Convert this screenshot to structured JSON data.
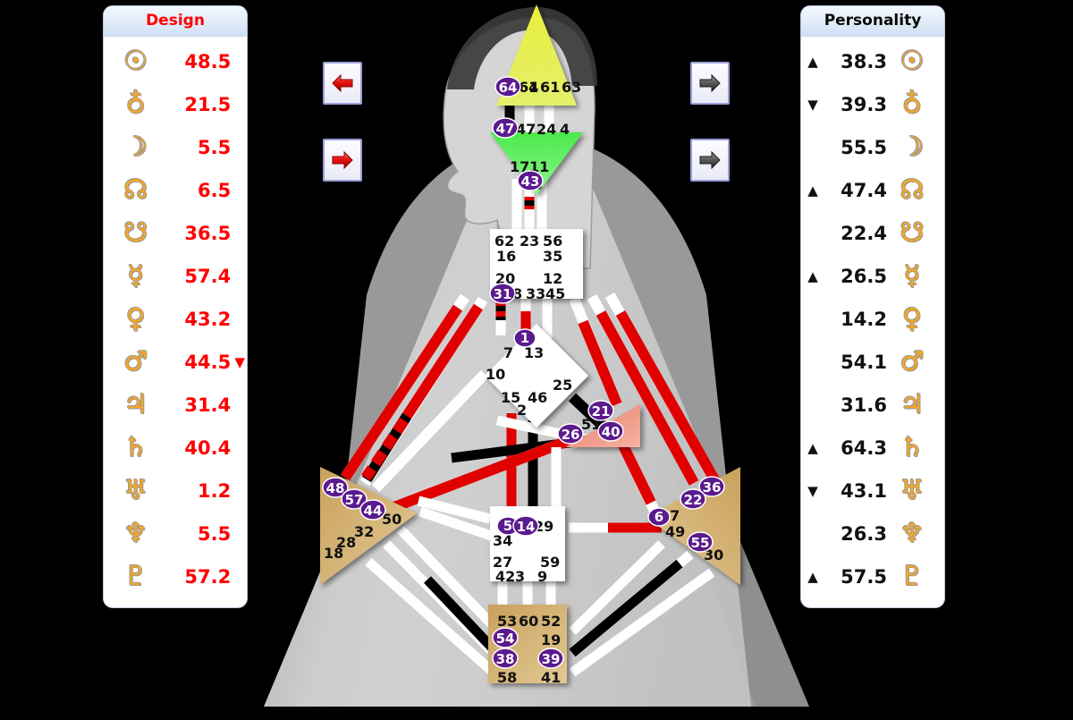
{
  "design_panel": {
    "title": "Design",
    "accent": "#ff0000",
    "rows": [
      {
        "glyph": "sun-icon",
        "symbol": "☉",
        "value": "48.5",
        "mark": ""
      },
      {
        "glyph": "earth-icon",
        "symbol": "♁",
        "value": "21.5",
        "mark": ""
      },
      {
        "glyph": "moon-icon",
        "symbol": "☽",
        "value": "5.5",
        "mark": ""
      },
      {
        "glyph": "north-node-icon",
        "symbol": "☊",
        "value": "6.5",
        "mark": ""
      },
      {
        "glyph": "south-node-icon",
        "symbol": "☋",
        "value": "36.5",
        "mark": ""
      },
      {
        "glyph": "mercury-icon",
        "symbol": "☿",
        "value": "57.4",
        "mark": ""
      },
      {
        "glyph": "venus-icon",
        "symbol": "♀",
        "value": "43.2",
        "mark": ""
      },
      {
        "glyph": "mars-icon",
        "symbol": "♂",
        "value": "44.5",
        "mark": "▼"
      },
      {
        "glyph": "jupiter-icon",
        "symbol": "♃",
        "value": "31.4",
        "mark": ""
      },
      {
        "glyph": "saturn-icon",
        "symbol": "♄",
        "value": "40.4",
        "mark": ""
      },
      {
        "glyph": "uranus-icon",
        "symbol": "♅",
        "value": "1.2",
        "mark": ""
      },
      {
        "glyph": "neptune-icon",
        "symbol": "♆",
        "value": "5.5",
        "mark": ""
      },
      {
        "glyph": "pluto-icon",
        "symbol": "♇",
        "value": "57.2",
        "mark": ""
      }
    ]
  },
  "personality_panel": {
    "title": "Personality",
    "accent": "#111111",
    "rows": [
      {
        "glyph": "sun-icon",
        "symbol": "☉",
        "value": "38.3",
        "mark": "▲"
      },
      {
        "glyph": "earth-icon",
        "symbol": "♁",
        "value": "39.3",
        "mark": "▼"
      },
      {
        "glyph": "moon-icon",
        "symbol": "☽",
        "value": "55.5",
        "mark": ""
      },
      {
        "glyph": "north-node-icon",
        "symbol": "☊",
        "value": "47.4",
        "mark": "▲"
      },
      {
        "glyph": "south-node-icon",
        "symbol": "☋",
        "value": "22.4",
        "mark": ""
      },
      {
        "glyph": "mercury-icon",
        "symbol": "☿",
        "value": "26.5",
        "mark": "▲"
      },
      {
        "glyph": "venus-icon",
        "symbol": "♀",
        "value": "14.2",
        "mark": ""
      },
      {
        "glyph": "mars-icon",
        "symbol": "♂",
        "value": "54.1",
        "mark": ""
      },
      {
        "glyph": "jupiter-icon",
        "symbol": "♃",
        "value": "31.6",
        "mark": ""
      },
      {
        "glyph": "saturn-icon",
        "symbol": "♄",
        "value": "64.3",
        "mark": "▲"
      },
      {
        "glyph": "uranus-icon",
        "symbol": "♅",
        "value": "43.1",
        "mark": "▼"
      },
      {
        "glyph": "neptune-icon",
        "symbol": "♆",
        "value": "26.3",
        "mark": ""
      },
      {
        "glyph": "pluto-icon",
        "symbol": "♇",
        "value": "57.5",
        "mark": "▲"
      }
    ]
  },
  "nav_buttons": [
    {
      "name": "prev-design-button",
      "direction": "left",
      "color": "red"
    },
    {
      "name": "next-design-button",
      "direction": "right",
      "color": "red"
    },
    {
      "name": "prev-personality-button",
      "direction": "right",
      "color": "gray"
    },
    {
      "name": "next-personality-button",
      "direction": "right",
      "color": "gray"
    }
  ],
  "bodygraph": {
    "centers": [
      {
        "name": "head-center",
        "shape": "triangle-up",
        "fill": "#e9f04a",
        "defined": true
      },
      {
        "name": "ajna-center",
        "shape": "triangle-down",
        "fill": "#6ef06e",
        "defined": true
      },
      {
        "name": "throat-center",
        "shape": "square",
        "fill": "#ffffff",
        "defined": false
      },
      {
        "name": "g-center",
        "shape": "diamond",
        "fill": "#ffffff",
        "defined": false
      },
      {
        "name": "heart-center",
        "shape": "triangle-right",
        "fill": "#ef8a7a",
        "defined": true
      },
      {
        "name": "spleen-center",
        "shape": "triangle-right",
        "fill": "#cfa96a",
        "defined": true
      },
      {
        "name": "solar-plexus-center",
        "shape": "triangle-left",
        "fill": "#cfa96a",
        "defined": true
      },
      {
        "name": "sacral-center",
        "shape": "square",
        "fill": "#ffffff",
        "defined": false
      },
      {
        "name": "root-center",
        "shape": "square",
        "fill": "#cfa96a",
        "defined": true
      }
    ],
    "gate_labels": {
      "head": [
        "64",
        "61",
        "63"
      ],
      "ajna": [
        "47",
        "24",
        "4",
        "17",
        "11",
        "43"
      ],
      "throat": [
        "62",
        "23",
        "56",
        "16",
        "35",
        "20",
        "12",
        "31",
        "8",
        "33",
        "45"
      ],
      "g": [
        "1",
        "7",
        "13",
        "10",
        "25",
        "15",
        "46",
        "2"
      ],
      "heart": [
        "21",
        "51",
        "26",
        "40"
      ],
      "spleen": [
        "48",
        "57",
        "44",
        "50",
        "32",
        "28",
        "18"
      ],
      "solar_plexus": [
        "36",
        "22",
        "37",
        "6",
        "49",
        "55",
        "30"
      ],
      "sacral": [
        "5",
        "14",
        "29",
        "34",
        "27",
        "59",
        "42",
        "3",
        "9"
      ],
      "root": [
        "53",
        "60",
        "52",
        "54",
        "19",
        "38",
        "39",
        "58",
        "41"
      ]
    },
    "activated_gates": [
      "64",
      "47",
      "43",
      "31",
      "1",
      "21",
      "26",
      "40",
      "48",
      "57",
      "44",
      "36",
      "22",
      "55",
      "5",
      "14",
      "54",
      "38",
      "39"
    ],
    "colors": {
      "design_channel": "#ff0000",
      "personality_channel": "#000000",
      "open_channel": "#ffffff",
      "activation_badge": "#5b1a8e",
      "background": "#000000",
      "body_silhouette": "#c8c8c8"
    }
  }
}
